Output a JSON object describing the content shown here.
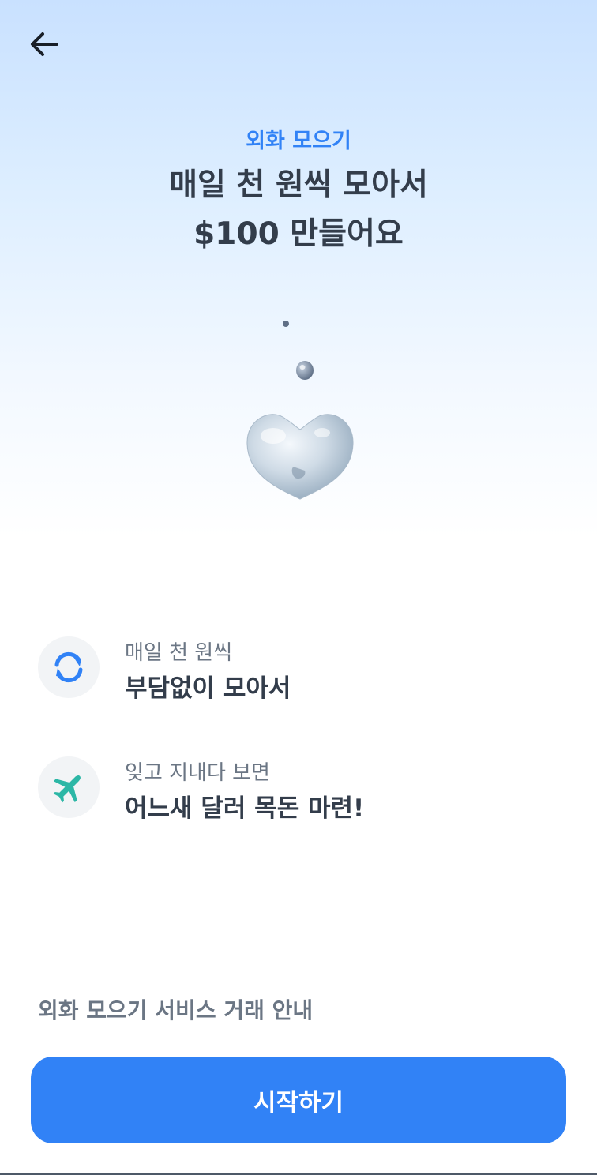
{
  "header": {
    "back_icon": "arrow-left-icon"
  },
  "hero": {
    "label": "외화 모으기",
    "title_line1": "매일 천 원씩 모아서",
    "title_line2": "$100 만들어요",
    "illustration_icon": "water-drop-heart-icon"
  },
  "features": [
    {
      "icon": "refresh-icon",
      "icon_color": "#3182f6",
      "subtitle": "매일 천 원씩",
      "title": "부담없이 모아서"
    },
    {
      "icon": "airplane-icon",
      "icon_color": "#2cb7a6",
      "subtitle": "잊고 지내다 보면",
      "title": "어느새 달러 목돈 마련!"
    }
  ],
  "notice": {
    "label": "외화 모으기 서비스 거래 안내"
  },
  "cta": {
    "label": "시작하기",
    "color": "#3182f6"
  },
  "colors": {
    "accent": "#3182f6",
    "text_primary": "#333d4b",
    "text_secondary": "#6b7684",
    "icon_bg": "#f2f4f6"
  }
}
